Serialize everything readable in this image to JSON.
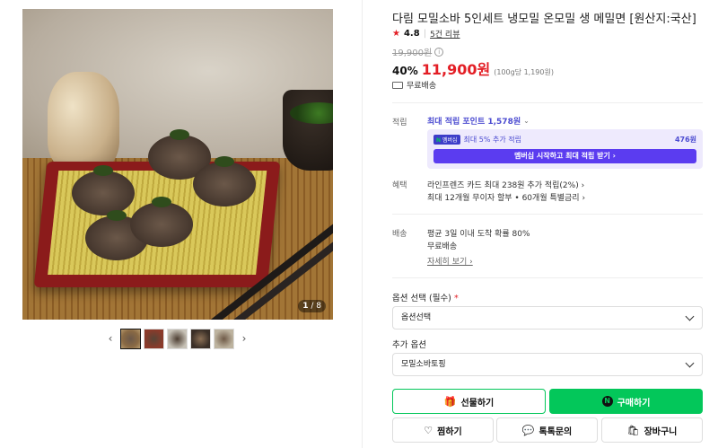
{
  "gallery": {
    "counter_current": "1",
    "counter_total": "/ 8",
    "prev_arrow": "‹",
    "next_arrow": "›"
  },
  "product": {
    "title": "다림 모밀소바 5인세트 냉모밀 온모밀 생 메밀면 [원산지:국산]",
    "rating": "4.8",
    "reviews": "5건 리뷰",
    "original_price": "19,900원",
    "discount_rate": "40%",
    "price": "11,900원",
    "unit_price": "(100g당 1,190원)",
    "shipping_summary": "무료배송"
  },
  "points": {
    "label": "적립",
    "max_points": "최대 적립 포인트 1,578원",
    "membership_badge": "멤버십",
    "extra_text": "최대 5% 추가 적립",
    "extra_amount": "476원",
    "membership_button": "멤버십 시작하고 최대 적립 받기 ›"
  },
  "benefits": {
    "label": "혜택",
    "card": "라인프렌즈 카드 최대 238원 추가 적립(2%) ›",
    "installment": "최대 12개월 무이자 할부 • 60개월 특별금리 ›"
  },
  "delivery": {
    "label": "배송",
    "arrival": "평균 3일 이내 도착 확률 80%",
    "fee": "무료배송",
    "detail_link": "자세히 보기 ›"
  },
  "options": {
    "required_label": "옵션 선택 (필수)",
    "required_mark": "*",
    "required_value": "옵션선택",
    "extra_label": "추가 옵션",
    "extra_value": "모밀소바토핑"
  },
  "actions": {
    "gift": "선물하기",
    "buy": "구매하기",
    "buy_logo": "N",
    "wish": "찜하기",
    "talk": "톡톡문의",
    "cart": "장바구니"
  },
  "colors": {
    "accent_green": "#03c75a",
    "price_red": "#e31e25",
    "membership_purple": "#5b3cf0"
  }
}
